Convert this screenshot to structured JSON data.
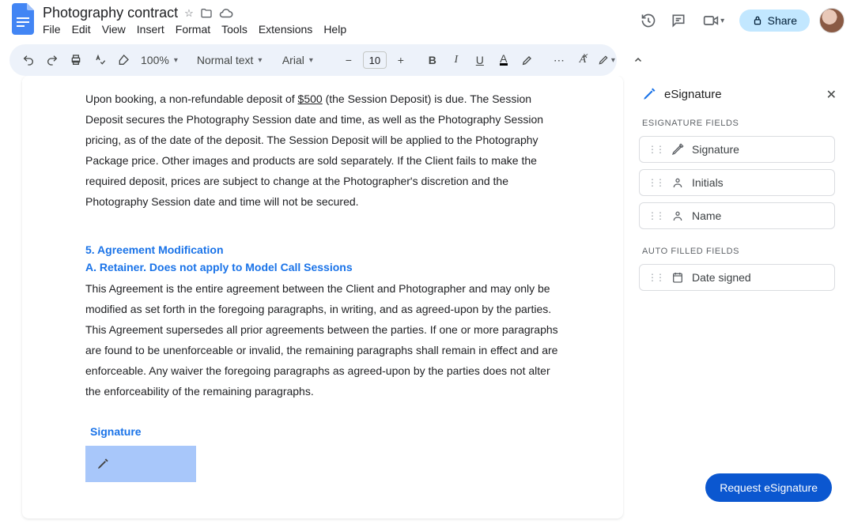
{
  "header": {
    "doc_title": "Photography contract",
    "menus": [
      "File",
      "Edit",
      "View",
      "Insert",
      "Format",
      "Tools",
      "Extensions",
      "Help"
    ],
    "share_label": "Share"
  },
  "toolbar": {
    "zoom": "100%",
    "style": "Normal text",
    "font": "Arial",
    "font_size": "10"
  },
  "document": {
    "para1_a": "Upon booking, a non-refundable deposit of ",
    "para1_amount": "$500",
    "para1_b": " (the Session Deposit) is due. The Session Deposit secures the Photography Session date and time, as well as the Photography Session pricing, as of the date of the deposit. The Session Deposit will be applied to the Photography Package price. Other images and products are sold separately. If the Client fails to make the required deposit, prices are subject to change at the Photographer's discretion and the Photography Session date and time will not be secured.",
    "sec5_head": "5. Agreement Modification",
    "sec5a_head": "A. Retainer.  Does not apply to Model Call Sessions",
    "para2": "This Agreement is the entire agreement between the Client and Photographer and may only be modified as set forth in the foregoing paragraphs, in writing, and as agreed-upon by the parties.  This Agreement supersedes all prior agreements between the parties. If one or more paragraphs are found to be unenforceable or invalid, the remaining paragraphs shall remain in effect and are enforceable. Any waiver the foregoing paragraphs as agreed-upon by the parties does not alter the enforceability of the remaining paragraphs.",
    "sig_label": "Signature"
  },
  "panel": {
    "title": "eSignature",
    "section1": "ESIGNATURE FIELDS",
    "fields": {
      "signature": "Signature",
      "initials": "Initials",
      "name": "Name"
    },
    "section2": "AUTO FILLED FIELDS",
    "date_signed": "Date signed",
    "request_label": "Request eSignature"
  }
}
